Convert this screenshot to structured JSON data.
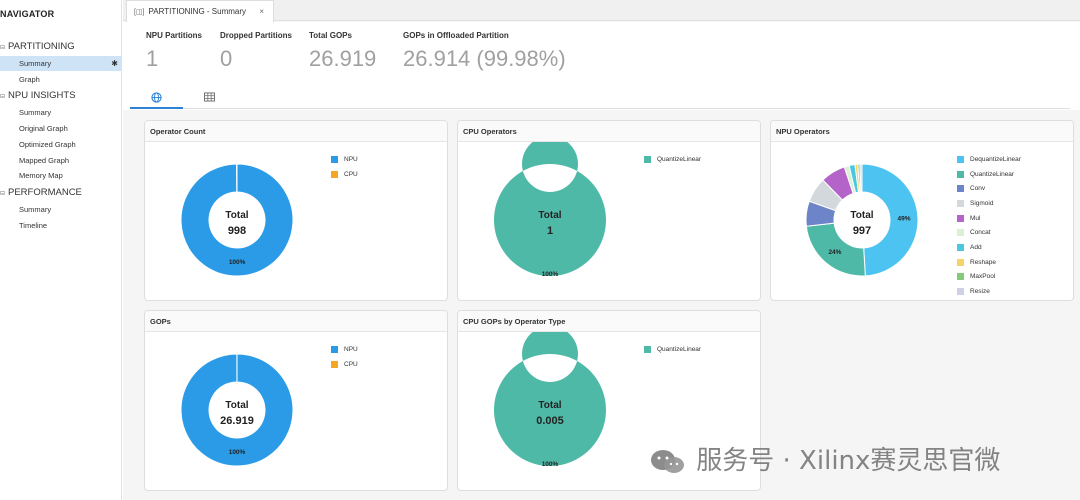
{
  "navigator": {
    "title": "NAVIGATOR",
    "sections": [
      {
        "label": "PARTITIONING",
        "items": [
          "Summary",
          "Graph"
        ]
      },
      {
        "label": "NPU INSIGHTS",
        "items": [
          "Summary",
          "Original Graph",
          "Optimized Graph",
          "Mapped Graph",
          "Memory Map"
        ]
      },
      {
        "label": "PERFORMANCE",
        "items": [
          "Summary",
          "Timeline"
        ]
      }
    ],
    "selected_star": "✱"
  },
  "editor_tab": {
    "label": "PARTITIONING - Summary",
    "close": "×"
  },
  "metrics": [
    {
      "label": "NPU Partitions",
      "value": "1"
    },
    {
      "label": "Dropped Partitions",
      "value": "0"
    },
    {
      "label": "Total GOPs",
      "value": "26.919"
    },
    {
      "label": "GOPs in Offloaded Partition",
      "value": "26.914 (99.98%)"
    }
  ],
  "view_tabs": [
    "globe-icon",
    "table-icon"
  ],
  "colors": {
    "npu_blue": "#2b9be8",
    "cpu_orange": "#f5a623",
    "quantize_teal": "#4fb9a7",
    "accent": "#2d82d6"
  },
  "chart_data": [
    {
      "type": "pie",
      "title": "Operator Count",
      "center_label": "Total",
      "center_value": "998",
      "legend": [
        {
          "name": "NPU",
          "color": "#2b9be8"
        },
        {
          "name": "CPU",
          "color": "#f5a623"
        }
      ],
      "slices": [
        {
          "name": "NPU",
          "value": 997,
          "color": "#2b9be8",
          "label": "100%"
        },
        {
          "name": "CPU",
          "value": 1,
          "color": "#f5a623",
          "label": ""
        }
      ]
    },
    {
      "type": "pie",
      "title": "CPU Operators",
      "center_label": "Total",
      "center_value": "1",
      "legend": [
        {
          "name": "QuantizeLinear",
          "color": "#4fb9a7"
        }
      ],
      "slices": [
        {
          "name": "QuantizeLinear",
          "value": 1,
          "color": "#4fb9a7",
          "label": "100%"
        }
      ]
    },
    {
      "type": "pie",
      "title": "NPU Operators",
      "center_label": "Total",
      "center_value": "997",
      "legend": [
        {
          "name": "DequantizeLinear",
          "color": "#4cc3f0"
        },
        {
          "name": "QuantizeLinear",
          "color": "#4fb9a7"
        },
        {
          "name": "Conv",
          "color": "#6d84c9"
        },
        {
          "name": "Sigmoid",
          "color": "#d3d8dd"
        },
        {
          "name": "Mul",
          "color": "#b464c8"
        },
        {
          "name": "Concat",
          "color": "#dcf0d6"
        },
        {
          "name": "Add",
          "color": "#4bc8df"
        },
        {
          "name": "Reshape",
          "color": "#f6d268"
        },
        {
          "name": "MaxPool",
          "color": "#86c97a"
        },
        {
          "name": "Resize",
          "color": "#cfcfe6"
        }
      ],
      "slices": [
        {
          "name": "DequantizeLinear",
          "value": 489,
          "color": "#4cc3f0",
          "label": "49%"
        },
        {
          "name": "QuantizeLinear",
          "value": 241,
          "color": "#4fb9a7",
          "label": "24%"
        },
        {
          "name": "Conv",
          "value": 72,
          "color": "#6d84c9",
          "label": ""
        },
        {
          "name": "Sigmoid",
          "value": 72,
          "color": "#d3d8dd",
          "label": ""
        },
        {
          "name": "Mul",
          "value": 72,
          "color": "#b464c8",
          "label": ""
        },
        {
          "name": "Concat",
          "value": 14,
          "color": "#dcf0d6",
          "label": ""
        },
        {
          "name": "Add",
          "value": 17,
          "color": "#4bc8df",
          "label": ""
        },
        {
          "name": "Reshape",
          "value": 8,
          "color": "#f6d268",
          "label": ""
        },
        {
          "name": "MaxPool",
          "value": 6,
          "color": "#86c97a",
          "label": ""
        },
        {
          "name": "Resize",
          "value": 6,
          "color": "#cfcfe6",
          "label": ""
        }
      ]
    },
    {
      "type": "pie",
      "title": "GOPs",
      "center_label": "Total",
      "center_value": "26.919",
      "legend": [
        {
          "name": "NPU",
          "color": "#2b9be8"
        },
        {
          "name": "CPU",
          "color": "#f5a623"
        }
      ],
      "slices": [
        {
          "name": "NPU",
          "value": 26.914,
          "color": "#2b9be8",
          "label": "100%"
        },
        {
          "name": "CPU",
          "value": 0.005,
          "color": "#f5a623",
          "label": ""
        }
      ]
    },
    {
      "type": "pie",
      "title": "CPU GOPs by Operator Type",
      "center_label": "Total",
      "center_value": "0.005",
      "legend": [
        {
          "name": "QuantizeLinear",
          "color": "#4fb9a7"
        }
      ],
      "slices": [
        {
          "name": "QuantizeLinear",
          "value": 0.005,
          "color": "#4fb9a7",
          "label": "100%"
        }
      ]
    }
  ],
  "watermark": "服务号 · Xilinx赛灵思官微"
}
